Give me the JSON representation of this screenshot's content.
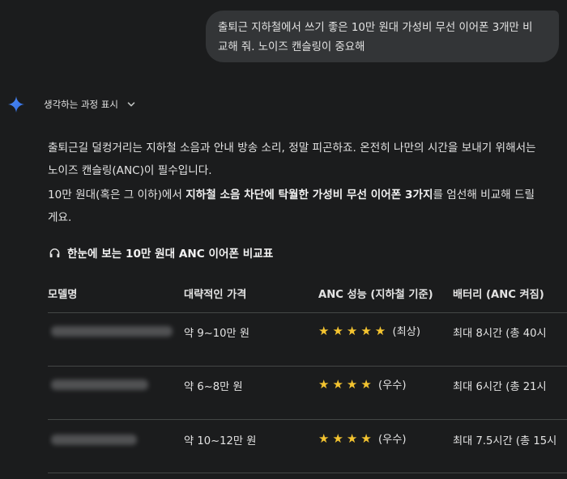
{
  "user_message": {
    "line1": "출퇴근 지하철에서 쓰기 좋은 10만 원대 가성비 무선 이어폰 3개만 비",
    "line2": "교해 줘. 노이즈 캔슬링이 중요해"
  },
  "thinking_toggle": {
    "label": "생각하는 과정 표시",
    "icon": "chevron-down-icon"
  },
  "response": {
    "p1_line1": "출퇴근길 덜컹거리는 지하철 소음과 안내 방송 소리, 정말 피곤하죠. 온전히 나만의 시간을 보내기 위해서는",
    "p1_line2": "노이즈 캔슬링(ANC)이 필수입니다.",
    "p2_pre": "10만 원대(혹은 그 이하)에서 ",
    "p2_bold": "지하철 소음 차단에 탁월한 가성비 무선 이어폰 3가지",
    "p2_post": "를 엄선해 비교해 드릴",
    "p2_line2": "게요.",
    "section_title": "한눈에 보는 10만 원대 ANC 이어폰 비교표",
    "section_icon": "headphones-icon"
  },
  "table": {
    "headers": [
      "모델명",
      "대략적인 가격",
      "ANC 성능 (지하철 기준)",
      "배터리 (ANC 켜짐)"
    ],
    "rows": [
      {
        "price": "약 9~10만 원",
        "stars": "★★★★★",
        "anc_rating": 5,
        "anc": "(최상)",
        "battery": "최대 8시간 (총 40시"
      },
      {
        "price": "약 6~8만 원",
        "stars": "★★★★",
        "anc_rating": 4,
        "anc": "(우수)",
        "battery": "최대 6시간 (총 21시"
      },
      {
        "price": "약 10~12만 원",
        "stars": "★★★★",
        "anc_rating": 4,
        "anc": "(우수)",
        "battery": "최대 7.5시간 (총 15시"
      }
    ]
  },
  "colors": {
    "background": "#1b1c1d",
    "bubble": "#333537",
    "star": "#f4c430",
    "divider": "#444746"
  }
}
